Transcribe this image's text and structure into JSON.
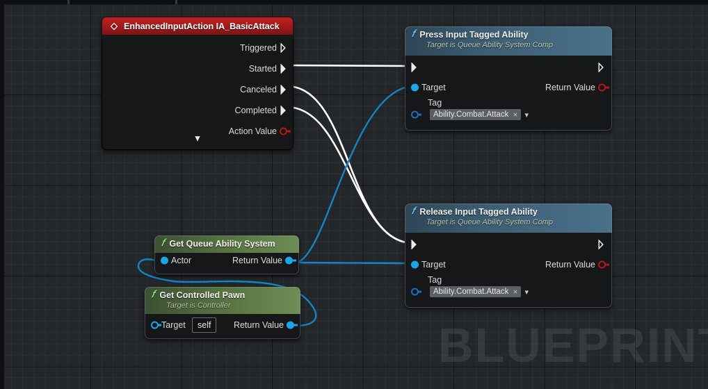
{
  "app": {
    "watermark": "BLUEPRINT",
    "canvas_bg": "#242729",
    "grid_minor_color": "rgba(255,255,255,0.035)",
    "grid_major_color": "rgba(0,0,0,0.55)"
  },
  "nodes": {
    "event_input_action": {
      "title": "EnhancedInputAction IA_BasicAttack",
      "header_color": "#a81a1a",
      "icon": "event-diamond-icon",
      "outputs": [
        {
          "label": "Triggered",
          "pin": "exec",
          "connected": false
        },
        {
          "label": "Started",
          "pin": "exec",
          "connected": true
        },
        {
          "label": "Canceled",
          "pin": "exec",
          "connected": true
        },
        {
          "label": "Completed",
          "pin": "exec",
          "connected": true
        },
        {
          "label": "Action Value",
          "pin": "ring-red",
          "connected": false
        }
      ],
      "collapse_glyph": "chevron-down"
    },
    "press_input_tagged_ability": {
      "title": "Press Input Tagged Ability",
      "subtitle": "Target is Queue Ability System Comp",
      "header_color": "#3d5f74",
      "icon": "function-f-icon",
      "exec_in": "",
      "exec_out": "",
      "inputs": [
        {
          "label": "Target",
          "pin": "filled-blue"
        }
      ],
      "outputs": [
        {
          "label": "Return Value",
          "pin": "ring-red"
        }
      ],
      "tag_field": {
        "label": "Tag",
        "value": "Ability.Combat.Attack",
        "clear_glyph": "×",
        "dropdown_glyph": "chevron-down",
        "pin": "ring-darkblue"
      }
    },
    "release_input_tagged_ability": {
      "title": "Release Input Tagged Ability",
      "subtitle": "Target is Queue Ability System Comp",
      "header_color": "#3d5f74",
      "icon": "function-f-icon",
      "inputs": [
        {
          "label": "Target",
          "pin": "filled-blue"
        }
      ],
      "outputs": [
        {
          "label": "Return Value",
          "pin": "ring-red"
        }
      ],
      "tag_field": {
        "label": "Tag",
        "value": "Ability.Combat.Attack",
        "clear_glyph": "×",
        "dropdown_glyph": "chevron-down",
        "pin": "ring-darkblue"
      }
    },
    "get_queue_ability_system": {
      "title": "Get Queue Ability System",
      "header_color": "#55703f",
      "icon": "function-f-icon",
      "inputs": [
        {
          "label": "Actor",
          "pin": "filled-blue"
        }
      ],
      "outputs": [
        {
          "label": "Return Value",
          "pin": "filled-blue"
        }
      ]
    },
    "get_controlled_pawn": {
      "title": "Get Controlled Pawn",
      "subtitle": "Target is Controller",
      "header_color": "#55703f",
      "icon": "function-f-icon",
      "inputs": [
        {
          "label": "Target",
          "pin": "ring-blue",
          "value": "self"
        }
      ],
      "outputs": [
        {
          "label": "Return Value",
          "pin": "filled-blue"
        }
      ]
    }
  },
  "wires": {
    "exec_color": "#ffffff",
    "data_color": "#1185c8",
    "connections": [
      {
        "from": "event_input_action.Started",
        "to": "press_input_tagged_ability.exec_in",
        "type": "exec"
      },
      {
        "from": "event_input_action.Canceled",
        "to": "release_input_tagged_ability.exec_in",
        "type": "exec"
      },
      {
        "from": "event_input_action.Completed",
        "to": "release_input_tagged_ability.exec_in",
        "type": "exec"
      },
      {
        "from": "get_queue_ability_system.Return Value",
        "to": "press_input_tagged_ability.Target",
        "type": "data"
      },
      {
        "from": "get_queue_ability_system.Return Value",
        "to": "release_input_tagged_ability.Target",
        "type": "data"
      },
      {
        "from": "get_controlled_pawn.Return Value",
        "to": "get_queue_ability_system.Actor",
        "type": "data"
      }
    ]
  }
}
